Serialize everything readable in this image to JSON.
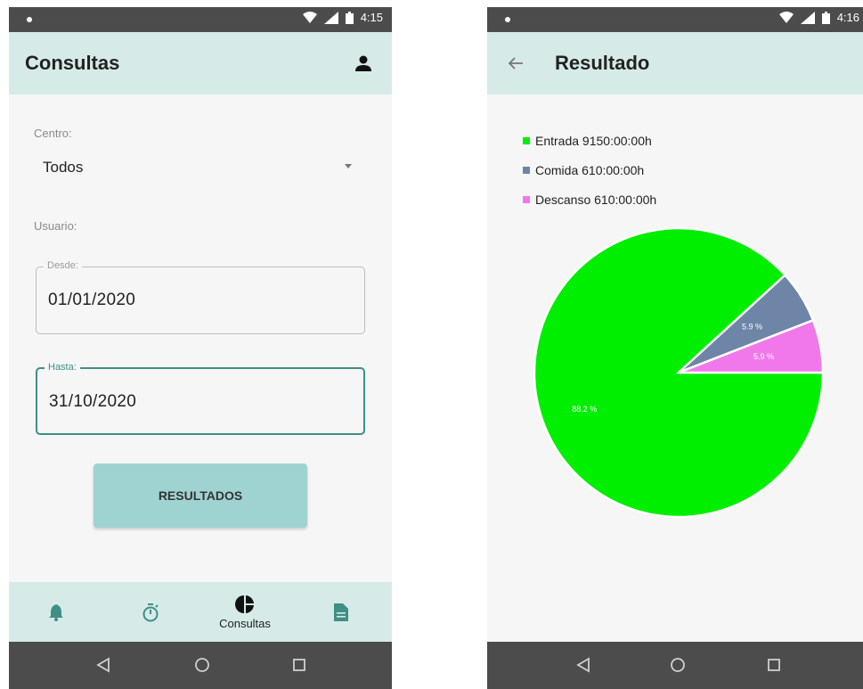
{
  "status_bar": {
    "time_left": "4:15",
    "time_right": "4:16"
  },
  "left_screen": {
    "title": "Consultas",
    "centro_label": "Centro:",
    "centro_value": "Todos",
    "usuario_label": "Usuario:",
    "desde": {
      "label": "Desde:",
      "value": "01/01/2020"
    },
    "hasta": {
      "label": "Hasta:",
      "value": "31/10/2020"
    },
    "results_button": "RESULTADOS",
    "bottom_nav": [
      {
        "icon": "bell-icon",
        "label": ""
      },
      {
        "icon": "stopwatch-icon",
        "label": ""
      },
      {
        "icon": "pie-chart-icon",
        "label": "Consultas",
        "active": true
      },
      {
        "icon": "document-icon",
        "label": ""
      }
    ]
  },
  "right_screen": {
    "title": "Resultado"
  },
  "colors": {
    "app_bar": "#d6ebe7",
    "accent": "#3f8f86",
    "button": "#9fd3d1",
    "status_bar": "#4c4c4c"
  },
  "chart_data": {
    "type": "pie",
    "legend_position": "top-left",
    "series": [
      {
        "name": "Entrada 9150:00:00h",
        "value": 88.2,
        "label": "88.2 %",
        "color": "#00ee00"
      },
      {
        "name": "Comida 610:00:00h",
        "value": 5.9,
        "label": "5.9 %",
        "color": "#6e85a8"
      },
      {
        "name": "Descanso 610:00:00h",
        "value": 5.9,
        "label": "5.9 %",
        "color": "#f178ea"
      }
    ]
  }
}
